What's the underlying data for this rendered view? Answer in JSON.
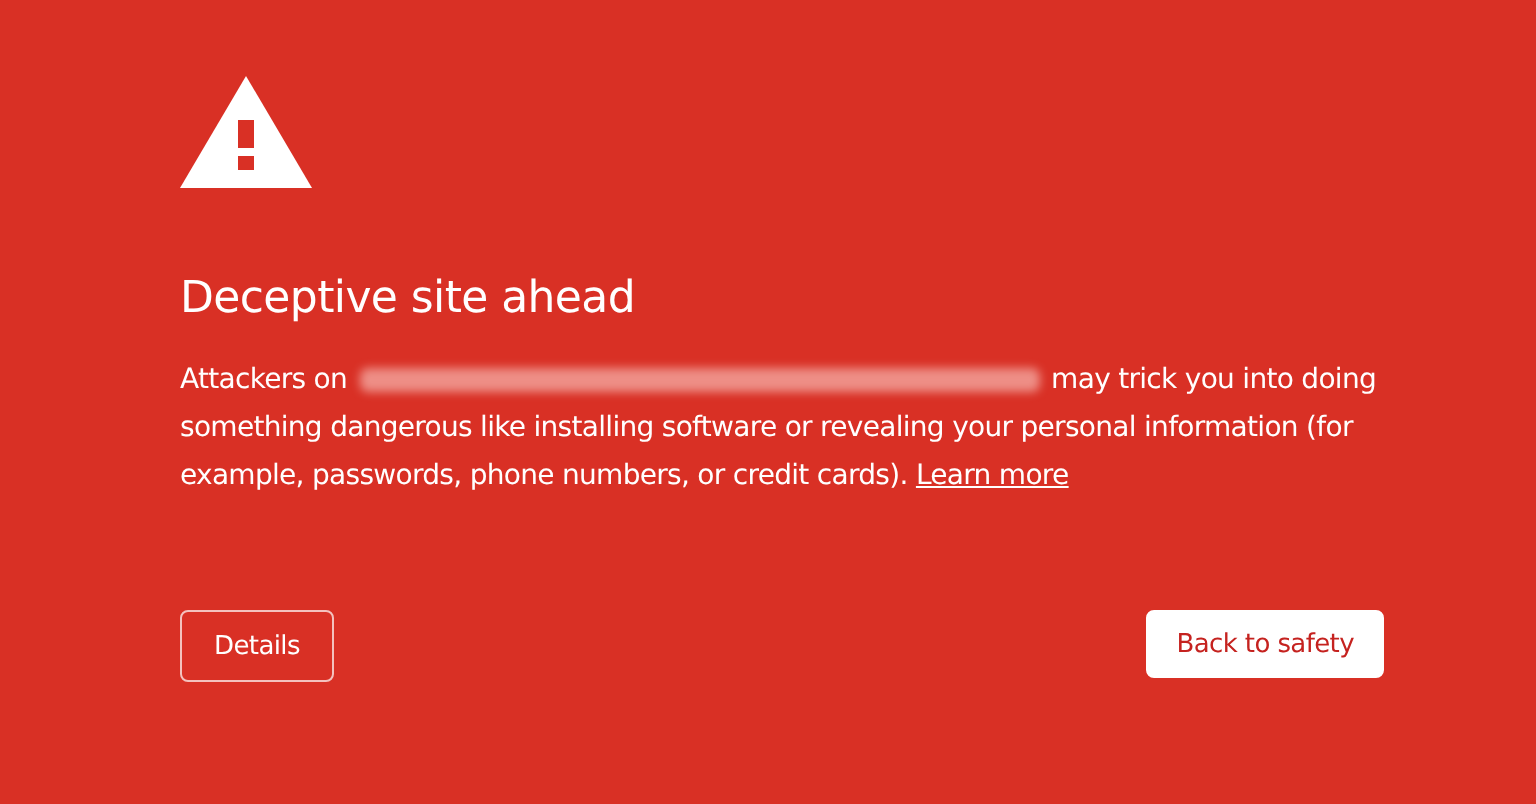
{
  "icon": {
    "kind": "warning"
  },
  "heading": "Deceptive site ahead",
  "message": {
    "before": "Attackers on",
    "redacted": true,
    "after": "may trick you into doing something dangerous like installing software or revealing your personal information (for example, passwords, phone numbers, or credit cards).",
    "link": "Learn more"
  },
  "buttons": [
    {
      "label": "Details",
      "kind": "secondary"
    },
    {
      "label": "Back to safety",
      "kind": "primary"
    }
  ]
}
